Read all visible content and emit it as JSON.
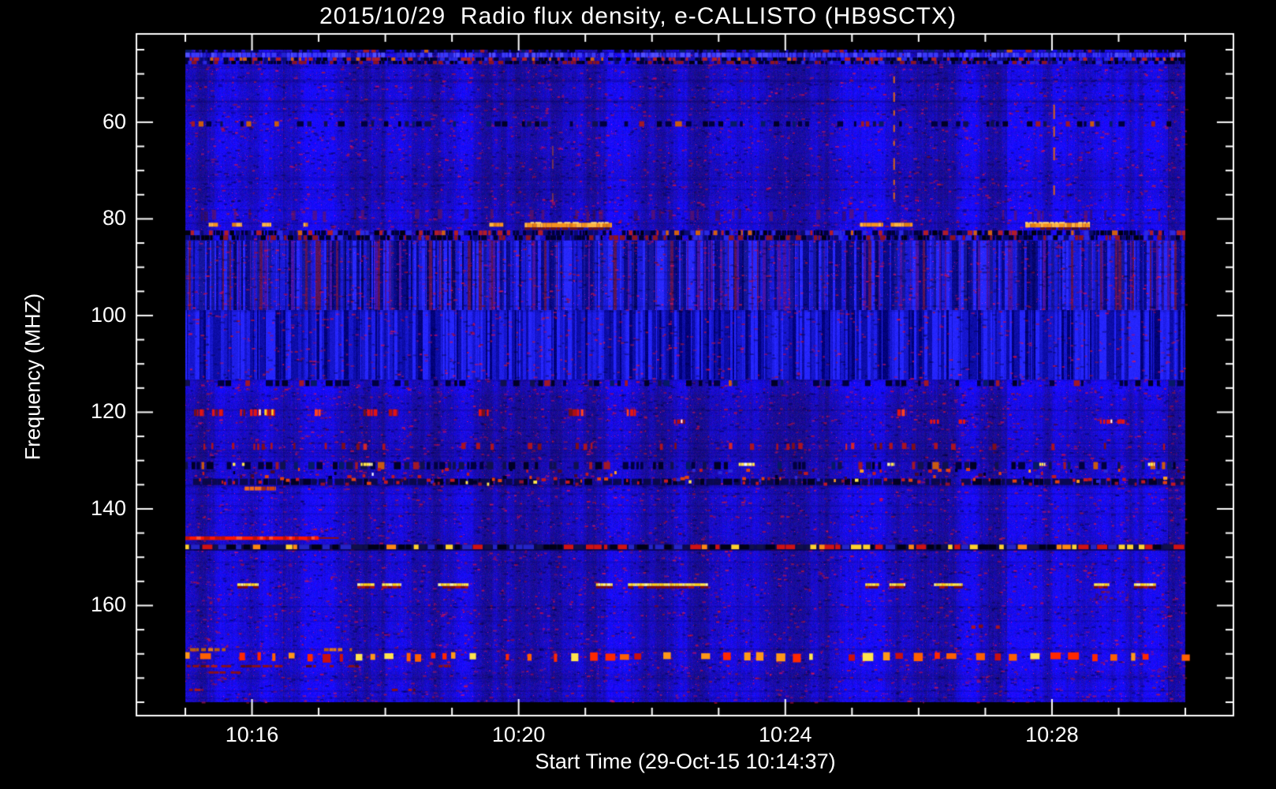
{
  "title": "2015/10/29  Radio flux density, e-CALLISTO (HB9SCTX)",
  "chart_data": {
    "type": "heatmap",
    "subtype": "radio-spectrogram",
    "title": "2015/10/29  Radio flux density, e-CALLISTO (HB9SCTX)",
    "xlabel": "Start Time (29-Oct-15 10:14:37)",
    "ylabel": "Frequency (MHZ)",
    "instrument": "e-CALLISTO (HB9SCTX)",
    "date": "2015/10/29",
    "start_time": "10:14:37",
    "x_ticks": [
      {
        "label": "10:16",
        "minutes": 16
      },
      {
        "label": "10:20",
        "minutes": 20
      },
      {
        "label": "10:24",
        "minutes": 24
      },
      {
        "label": "10:28",
        "minutes": 28
      }
    ],
    "x_minor_step_min": 1,
    "y_ticks": [
      {
        "label": "60",
        "mhz": 60
      },
      {
        "label": "80",
        "mhz": 80
      },
      {
        "label": "100",
        "mhz": 100
      },
      {
        "label": "120",
        "mhz": 120
      },
      {
        "label": "140",
        "mhz": 140
      },
      {
        "label": "160",
        "mhz": 160
      }
    ],
    "y_minor_step_mhz": 5,
    "time_range_min": [
      15.0,
      30.0
    ],
    "freq_range_mhz": [
      45,
      180
    ],
    "y_axis_inverted": true,
    "grid": false,
    "legend": false,
    "colors": {
      "background": "#000000",
      "base_blue": "#1c1ce8",
      "axis": "#ffffff",
      "bright_orange": "#ff9828",
      "yellow": "#ffe44a",
      "red": "#ff2000",
      "dark_red": "#7a0f14"
    },
    "features": [
      {
        "name": "top-edge-dark-row",
        "kind": "dark-dash-band",
        "f0": 45.0,
        "f1": 45.6,
        "density": 0.75
      },
      {
        "name": "top-bright-row",
        "kind": "bright-noise-band",
        "f0": 45.6,
        "f1": 46.6
      },
      {
        "name": "top-speckle-band",
        "kind": "speckle-band",
        "f0": 46.6,
        "f1": 48.0,
        "density": 0.85
      },
      {
        "name": "quiet-dark-line-60mhz",
        "kind": "dark-dash-band",
        "f0": 59.8,
        "f1": 60.9,
        "density": 0.55
      },
      {
        "name": "red-fuzz-79mhz",
        "kind": "red-fuzz-band",
        "f0": 78.3,
        "f1": 80.3,
        "density": 0.3
      },
      {
        "name": "orange-bursts-81mhz",
        "kind": "orange-segments",
        "f0": 80.8,
        "f1": 81.8,
        "segments": [
          [
            15.35,
            15.49
          ],
          [
            15.7,
            15.85
          ],
          [
            16.15,
            16.29
          ],
          [
            16.77,
            16.84
          ],
          [
            19.56,
            19.77
          ],
          [
            20.09,
            21.4
          ],
          [
            25.12,
            25.47
          ],
          [
            25.58,
            25.91
          ],
          [
            27.6,
            28.57
          ]
        ],
        "bright": [
          5,
          8
        ]
      },
      {
        "name": "speckle-band-83mhz",
        "kind": "speckle-band",
        "f0": 82.4,
        "f1": 84.4,
        "density": 0.9
      },
      {
        "name": "vertical-stripe-band-upper",
        "kind": "stripe-band",
        "f0": 84.5,
        "f1": 98.8,
        "palette": [
          [
            "#0a0a8c",
            0.22
          ],
          [
            "#1a1ad8",
            0.2
          ],
          [
            "#2828ff",
            0.18
          ],
          [
            "#16169e",
            0.14
          ],
          [
            "#4514a8",
            0.12
          ],
          [
            "#5a1458",
            0.06
          ],
          [
            "#06066a",
            0.08
          ]
        ]
      },
      {
        "name": "vertical-stripe-band-lower",
        "kind": "stripe-band",
        "f0": 98.8,
        "f1": 113.2,
        "palette": [
          [
            "#0d0da8",
            0.25
          ],
          [
            "#2525ff",
            0.3
          ],
          [
            "#1616cc",
            0.2
          ],
          [
            "#02027a",
            0.15
          ],
          [
            "#1e1ee8",
            0.1
          ]
        ]
      },
      {
        "name": "dark-row-113mhz",
        "kind": "dark-dash-band",
        "f0": 113.4,
        "f1": 114.6,
        "density": 0.5
      },
      {
        "name": "rfi-dashes-120mhz",
        "kind": "red-dash-segments",
        "f0": 119.4,
        "f1": 120.8,
        "segments": [
          [
            15.13,
            15.28
          ],
          [
            15.4,
            15.57
          ],
          [
            15.82,
            15.9
          ],
          [
            15.97,
            16.37
          ],
          [
            16.94,
            17.03
          ],
          [
            17.67,
            17.89
          ],
          [
            18.05,
            18.19
          ],
          [
            19.4,
            19.55
          ],
          [
            20.75,
            21.0
          ],
          [
            21.62,
            21.76
          ],
          [
            25.68,
            25.82
          ]
        ],
        "white": [
          2,
          3
        ]
      },
      {
        "name": "rfi-dashes-122mhz",
        "kind": "red-dash-segments",
        "f0": 121.5,
        "f1": 122.4,
        "segments": [
          [
            22.33,
            22.5
          ],
          [
            26.17,
            26.31
          ],
          [
            26.6,
            26.7
          ],
          [
            28.72,
            28.92
          ],
          [
            28.98,
            29.12
          ]
        ],
        "white": [
          0,
          3
        ]
      },
      {
        "name": "sparse-red-line-127mhz",
        "kind": "sparse-red-line",
        "f0": 126.5,
        "f1": 127.8,
        "density": 0.3
      },
      {
        "name": "dark-band-131mhz",
        "kind": "dark-dash-band",
        "f0": 130.3,
        "f1": 131.8,
        "density": 0.6,
        "bright_blobs": [
          [
            15.71,
            15.89
          ],
          [
            17.63,
            17.81
          ],
          [
            23.3,
            23.54
          ],
          [
            25.53,
            25.64
          ],
          [
            27.81,
            27.9
          ],
          [
            29.44,
            29.54
          ]
        ]
      },
      {
        "name": "busy-noise-band-134mhz",
        "kind": "busy-band",
        "f0": 133.0,
        "f1": 135.8,
        "orange_blob": [
          15.89,
          16.36
        ]
      },
      {
        "name": "strong-red-line-146mhz",
        "kind": "solid-red-line",
        "f0": 145.7,
        "f1": 146.4,
        "t0": 15.0,
        "t1": 17.0,
        "tail_t1": 17.3
      },
      {
        "name": "mixed-dash-line-148mhz",
        "kind": "mixed-dash-line",
        "f0": 147.4,
        "f1": 148.5
      },
      {
        "name": "yellow-bursts-156mhz",
        "kind": "yellow-segments",
        "f0": 155.4,
        "f1": 156.6,
        "segments": [
          [
            15.78,
            16.1
          ],
          [
            17.58,
            17.84
          ],
          [
            17.95,
            18.24
          ],
          [
            18.79,
            19.25
          ],
          [
            21.16,
            21.41
          ],
          [
            21.64,
            22.84
          ],
          [
            25.2,
            25.41
          ],
          [
            25.56,
            25.8
          ],
          [
            26.23,
            26.66
          ],
          [
            28.63,
            28.86
          ],
          [
            29.23,
            29.56
          ]
        ]
      },
      {
        "name": "red-blotch-158mhz",
        "kind": "red-fuzz-patch",
        "f0": 157.0,
        "f1": 159.4,
        "t0": 28.57,
        "t1": 29.15,
        "density": 0.5
      },
      {
        "name": "red-dots-164mhz",
        "kind": "sparse-red-line",
        "f0": 164.1,
        "f1": 164.8,
        "t0": 26.79,
        "t1": 27.22,
        "density": 0.5
      },
      {
        "name": "orange-row-169mhz",
        "kind": "dim-orange-segments",
        "f0": 168.8,
        "f1": 169.7,
        "segments": [
          [
            15.07,
            15.65
          ],
          [
            17.08,
            17.5
          ]
        ]
      },
      {
        "name": "dense-rfi-line-170mhz",
        "kind": "dense-red-dash-line",
        "f0": 169.8,
        "f1": 171.4
      },
      {
        "name": "dim-red-underline-172mhz",
        "kind": "dim-red-segments",
        "f0": 172.3,
        "f1": 173.1,
        "segments": [
          [
            15.02,
            16.46
          ],
          [
            16.81,
            17.63
          ],
          [
            18.8,
            18.98
          ]
        ]
      },
      {
        "name": "dim-red-row-174mhz",
        "kind": "dim-red-segments",
        "f0": 173.6,
        "f1": 174.4,
        "segments": [
          [
            15.35,
            15.88
          ]
        ]
      },
      {
        "name": "bottom-red-specks",
        "kind": "dim-red-segments",
        "f0": 177.2,
        "f1": 178.3,
        "segments": [
          [
            15.06,
            15.27
          ],
          [
            18.1,
            18.45
          ]
        ]
      },
      {
        "name": "vertical-streak-1",
        "kind": "vertical-streak",
        "t": 20.5,
        "f0": 64.9,
        "f1": 74.7,
        "dim": true
      },
      {
        "name": "vertical-streak-2",
        "kind": "vertical-streak",
        "t": 22.89,
        "f0": 67.3,
        "f1": 73.1,
        "dim": true
      },
      {
        "name": "vertical-streak-3",
        "kind": "vertical-streak",
        "t": 25.62,
        "f0": 50.5,
        "f1": 74.7,
        "dim": false
      },
      {
        "name": "vertical-streak-4",
        "kind": "vertical-streak",
        "t": 28.02,
        "f0": 49.0,
        "f1": 74.2,
        "dim": false
      },
      {
        "name": "red-streak-135mhz",
        "kind": "vertical-streak",
        "t": 28.1,
        "f0": 130.7,
        "f1": 136.5,
        "dim": true,
        "red": true
      }
    ]
  }
}
